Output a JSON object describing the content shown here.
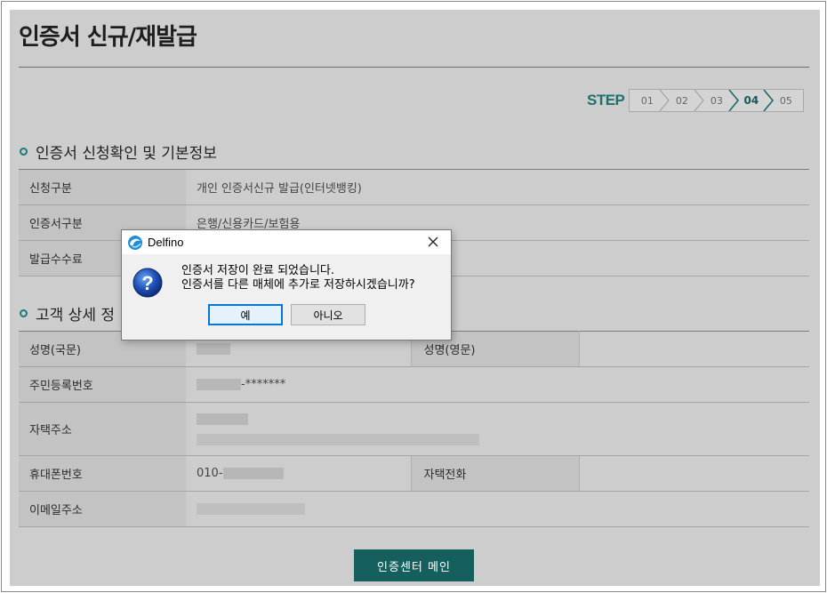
{
  "page": {
    "title": "인증서 신규/재발급"
  },
  "steps": {
    "label": "STEP",
    "items": [
      "01",
      "02",
      "03",
      "04",
      "05"
    ],
    "active_index": 3
  },
  "section1": {
    "heading": "인증서 신청확인 및 기본정보",
    "rows": [
      {
        "label": "신청구분",
        "value": "개인 인증서신규 발급(인터넷뱅킹)"
      },
      {
        "label": "인증서구분",
        "value": "은행/신용카드/보험용"
      },
      {
        "label": "발급수수료",
        "value": ""
      }
    ]
  },
  "section2": {
    "heading": "고객 상세 정",
    "name_kr_label": "성명(국문)",
    "name_en_label": "성명(영문)",
    "rrn_label": "주민등록번호",
    "rrn_suffix": "-*******",
    "address_label": "자택주소",
    "mobile_label": "휴대폰번호",
    "mobile_prefix": "010-",
    "home_phone_label": "자택전화",
    "email_label": "이메일주소"
  },
  "main_button_label": "인증센터 메인",
  "dialog": {
    "title": "Delfino",
    "message_line1": "인증서 저장이 완료 되었습니다.",
    "message_line2": "인증서를 다른 매체에 추가로 저장하시겠습니까?",
    "yes_label": "예",
    "no_label": "아니오"
  },
  "colors": {
    "accent": "#155f5f",
    "overlay_bg": "#cdcdcd",
    "dialog_default_border": "#0078d7"
  },
  "icons": {
    "dialog_app": "delfino-logo-icon",
    "dialog_type": "question-icon",
    "close": "close-icon"
  }
}
